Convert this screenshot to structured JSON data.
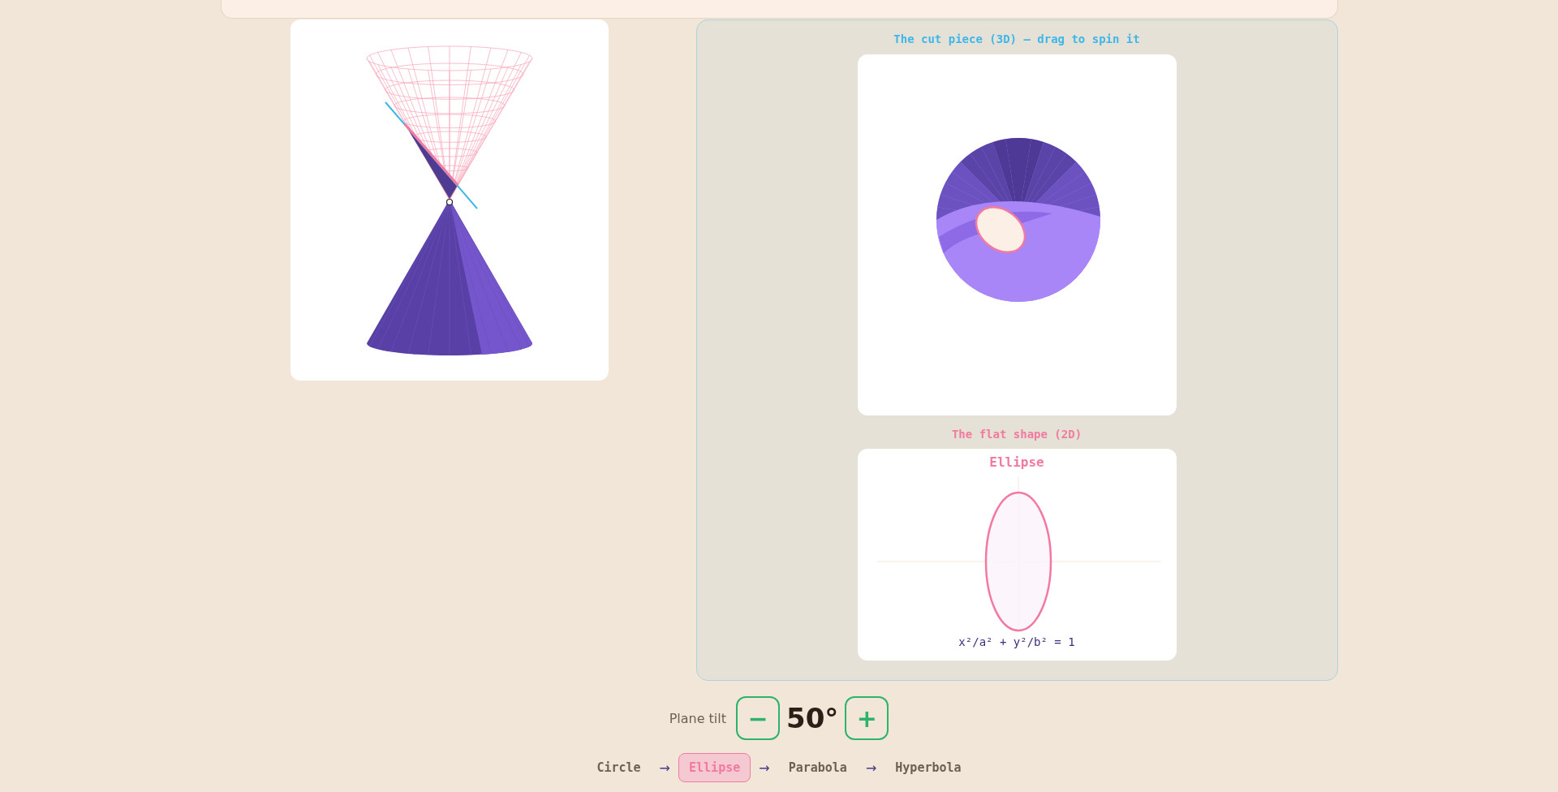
{
  "cut_piece": {
    "title": "The cut piece (3D) — drag to spin it"
  },
  "flat_shape": {
    "title": "The flat shape (2D)",
    "shape_name": "Ellipse",
    "equation": "x²/a² + y²/b² = 1"
  },
  "tilt": {
    "label": "Plane tilt",
    "decrease": "−",
    "value": "50°",
    "increase": "+"
  },
  "shapes": [
    {
      "label": "Circle",
      "selected": false
    },
    {
      "label": "Ellipse",
      "selected": true
    },
    {
      "label": "Parabola",
      "selected": false
    },
    {
      "label": "Hyperbola",
      "selected": false
    }
  ],
  "arrows": [
    "→",
    "→",
    "→"
  ]
}
